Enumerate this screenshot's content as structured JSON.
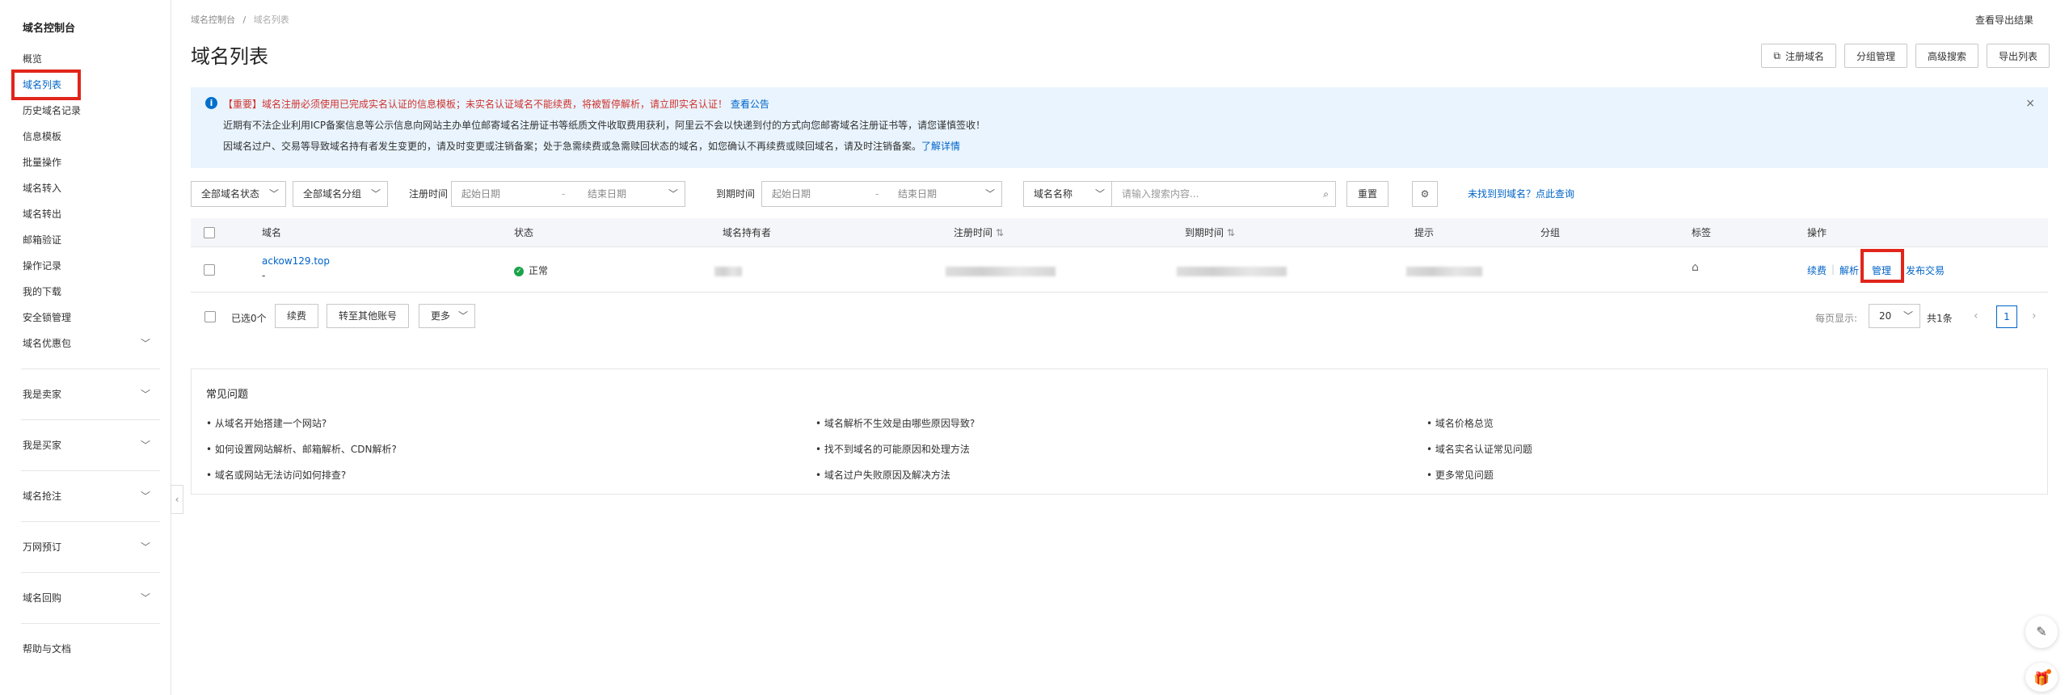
{
  "sidebar": {
    "title": "域名控制台",
    "items": [
      {
        "label": "概览"
      },
      {
        "label": "域名列表"
      },
      {
        "label": "历史域名记录"
      },
      {
        "label": "信息模板"
      },
      {
        "label": "批量操作"
      },
      {
        "label": "域名转入"
      },
      {
        "label": "域名转出"
      },
      {
        "label": "邮箱验证"
      },
      {
        "label": "操作记录"
      },
      {
        "label": "我的下载"
      },
      {
        "label": "安全锁管理"
      },
      {
        "label": "域名优惠包"
      }
    ],
    "groups": [
      {
        "label": "我是卖家"
      },
      {
        "label": "我是买家"
      },
      {
        "label": "域名抢注"
      },
      {
        "label": "万网预订"
      },
      {
        "label": "域名回购"
      }
    ],
    "help": "帮助与文档"
  },
  "breadcrumb": {
    "root": "域名控制台",
    "sep": "/",
    "current": "域名列表"
  },
  "header": {
    "export_results": "查看导出结果",
    "title": "域名列表",
    "buttons": {
      "register": "注册域名",
      "group": "分组管理",
      "advanced": "高级搜索",
      "export": "导出列表"
    }
  },
  "notice": {
    "line1": "【重要】域名注册必须使用已完成实名认证的信息模板；未实名认证域名不能续费，将被暂停解析，请立即实名认证！",
    "line1_link": "查看公告",
    "line2": "近期有不法企业利用ICP备案信息等公示信息向网站主办单位邮寄域名注册证书等纸质文件收取费用获利，阿里云不会以快递到付的方式向您邮寄域名注册证书等，请您谨慎签收！",
    "line3": "因域名过户、交易等导致域名持有者发生变更的，请及时变更或注销备案；处于急需续费或急需赎回状态的域名，如您确认不再续费或赎回域名，请及时注销备案。",
    "line3_link": "了解详情",
    "close": "×"
  },
  "filters": {
    "status": "全部域名状态",
    "group": "全部域名分组",
    "reg_label": "注册时间",
    "exp_label": "到期时间",
    "start_date": "起始日期",
    "end_date": "结束日期",
    "date_sep": "-",
    "field": "域名名称",
    "search_placeholder": "请输入搜索内容...",
    "reset": "重置",
    "not_found": "未找到到域名？点此查询"
  },
  "table": {
    "headers": {
      "domain": "域名",
      "status": "状态",
      "holder": "域名持有者",
      "reg_time": "注册时间",
      "exp_time": "到期时间",
      "hint": "提示",
      "group": "分组",
      "tag": "标签",
      "ops": "操作"
    },
    "sort_icon": "⇅",
    "rows": [
      {
        "domain": "ackow129.top",
        "sub": "-",
        "status": "正常",
        "ops": {
          "renew": "续费",
          "resolve": "解析",
          "manage": "管理",
          "trade": "发布交易"
        }
      }
    ]
  },
  "bulk": {
    "selected": "已选0个",
    "renew": "续费",
    "transfer": "转至其他账号",
    "more": "更多",
    "page_size_label": "每页显示:",
    "page_size": "20",
    "total": "共1条",
    "page": "1"
  },
  "faq": {
    "title": "常见问题",
    "items": [
      "从域名开始搭建一个网站?",
      "域名解析不生效是由哪些原因导致?",
      "域名价格总览",
      "如何设置网站解析、邮箱解析、CDN解析?",
      "找不到域名的可能原因和处理方法",
      "域名实名认证常见问题",
      "域名或网站无法访问如何排查?",
      "域名过户失败原因及解决方法",
      "更多常见问题"
    ]
  },
  "colors": {
    "accent": "#0064c8",
    "highlight": "#e1251b",
    "notice_bg": "#e9f4fe",
    "ok": "#1aa34a"
  }
}
